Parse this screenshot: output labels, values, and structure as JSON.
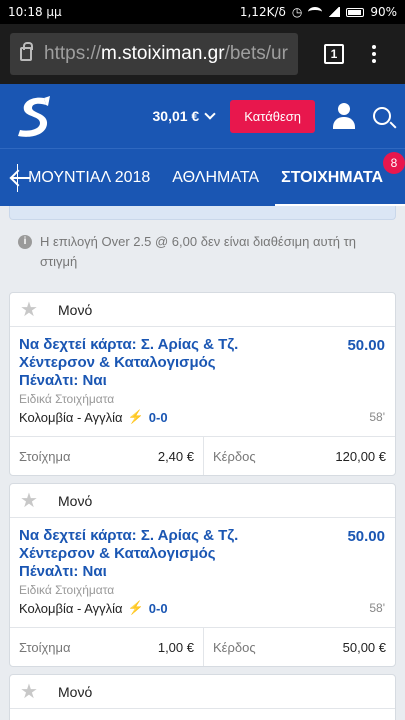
{
  "statusbar": {
    "time": "10:18 μμ",
    "speed": "1,12K/δ",
    "battery": "90%"
  },
  "browser": {
    "url_scheme": "https://",
    "url_host": "m.stoiximan.gr",
    "url_path": "/bets/ur",
    "tab_count": "1"
  },
  "header": {
    "balance": "30,01 €",
    "deposit_label": "Κατάθεση"
  },
  "nav": {
    "items": [
      {
        "label": "ΜΟΥΝΤΙΑΛ 2018"
      },
      {
        "label": "ΑΘΛΗΜΑΤΑ"
      },
      {
        "label": "ΣΤΟΙΧΗΜΑΤΑ"
      }
    ],
    "badge": "8"
  },
  "notice": {
    "text": "Η επιλογή Over 2.5 @ 6,00 δεν είναι διαθέσιμη αυτή τη στιγμή"
  },
  "bets": [
    {
      "type": "Μονό",
      "selection": "Να δεχτεί κάρτα: Σ. Αρίας & Τζ. Χέντερσον & Καταλογισμός Πέναλτι: Ναι",
      "odds": "50.00",
      "market": "Ειδικά Στοιχήματα",
      "match": "Κολομβία - Αγγλία",
      "score": "0-0",
      "minute": "58'",
      "stake_label": "Στοίχημα",
      "stake": "2,40 €",
      "win_label": "Κέρδος",
      "win": "120,00 €"
    },
    {
      "type": "Μονό",
      "selection": "Να δεχτεί κάρτα: Σ. Αρίας & Τζ. Χέντερσον & Καταλογισμός Πέναλτι: Ναι",
      "odds": "50.00",
      "market": "Ειδικά Στοιχήματα",
      "match": "Κολομβία - Αγγλία",
      "score": "0-0",
      "minute": "58'",
      "stake_label": "Στοίχημα",
      "stake": "1,00 €",
      "win_label": "Κέρδος",
      "win": "50,00 €"
    },
    {
      "type": "Μονό"
    }
  ]
}
